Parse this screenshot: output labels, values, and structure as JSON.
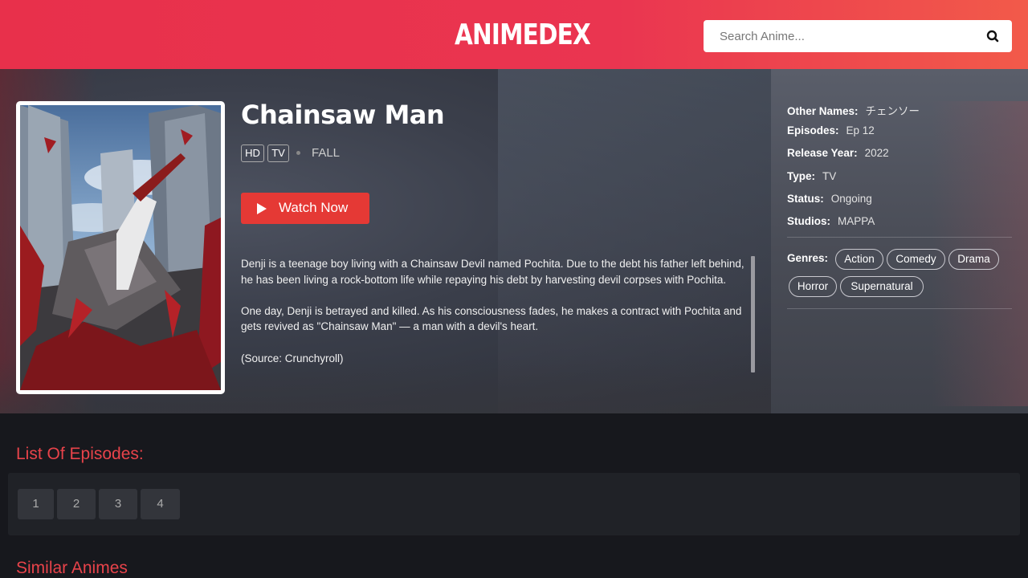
{
  "header": {
    "logo": "ANIMEDEX",
    "search_placeholder": "Search Anime..."
  },
  "anime": {
    "title": "Chainsaw Man",
    "badges": [
      "HD",
      "TV"
    ],
    "season": "FALL",
    "watch_label": "Watch Now",
    "synopsis": [
      "Denji is a teenage boy living with a Chainsaw Devil named Pochita. Due to the debt his father left behind, he has been living a rock-bottom life while repaying his debt by harvesting devil corpses with Pochita.",
      "One day, Denji is betrayed and killed. As his consciousness fades, he makes a contract with Pochita and gets revived as \"Chainsaw Man\" — a man with a devil's heart.",
      "(Source: Crunchyroll)"
    ]
  },
  "info": {
    "other_names_label": "Other Names:",
    "other_names": "チェンソー",
    "episodes_label": "Episodes:",
    "episodes": "Ep 12",
    "release_label": "Release Year:",
    "release": "2022",
    "type_label": "Type:",
    "type": "TV",
    "status_label": "Status:",
    "status": "Ongoing",
    "studios_label": "Studios:",
    "studios": "MAPPA",
    "genres_label": "Genres:",
    "genres": [
      "Action",
      "Comedy",
      "Drama",
      "Horror",
      "Supernatural"
    ]
  },
  "episodes_section": {
    "title": "List Of Episodes:",
    "episodes": [
      "1",
      "2",
      "3",
      "4"
    ]
  },
  "similar_section": {
    "title": "Similar Animes"
  },
  "colors": {
    "accent": "#e53935",
    "header_start": "#e8304b",
    "header_end": "#f25a4a"
  }
}
